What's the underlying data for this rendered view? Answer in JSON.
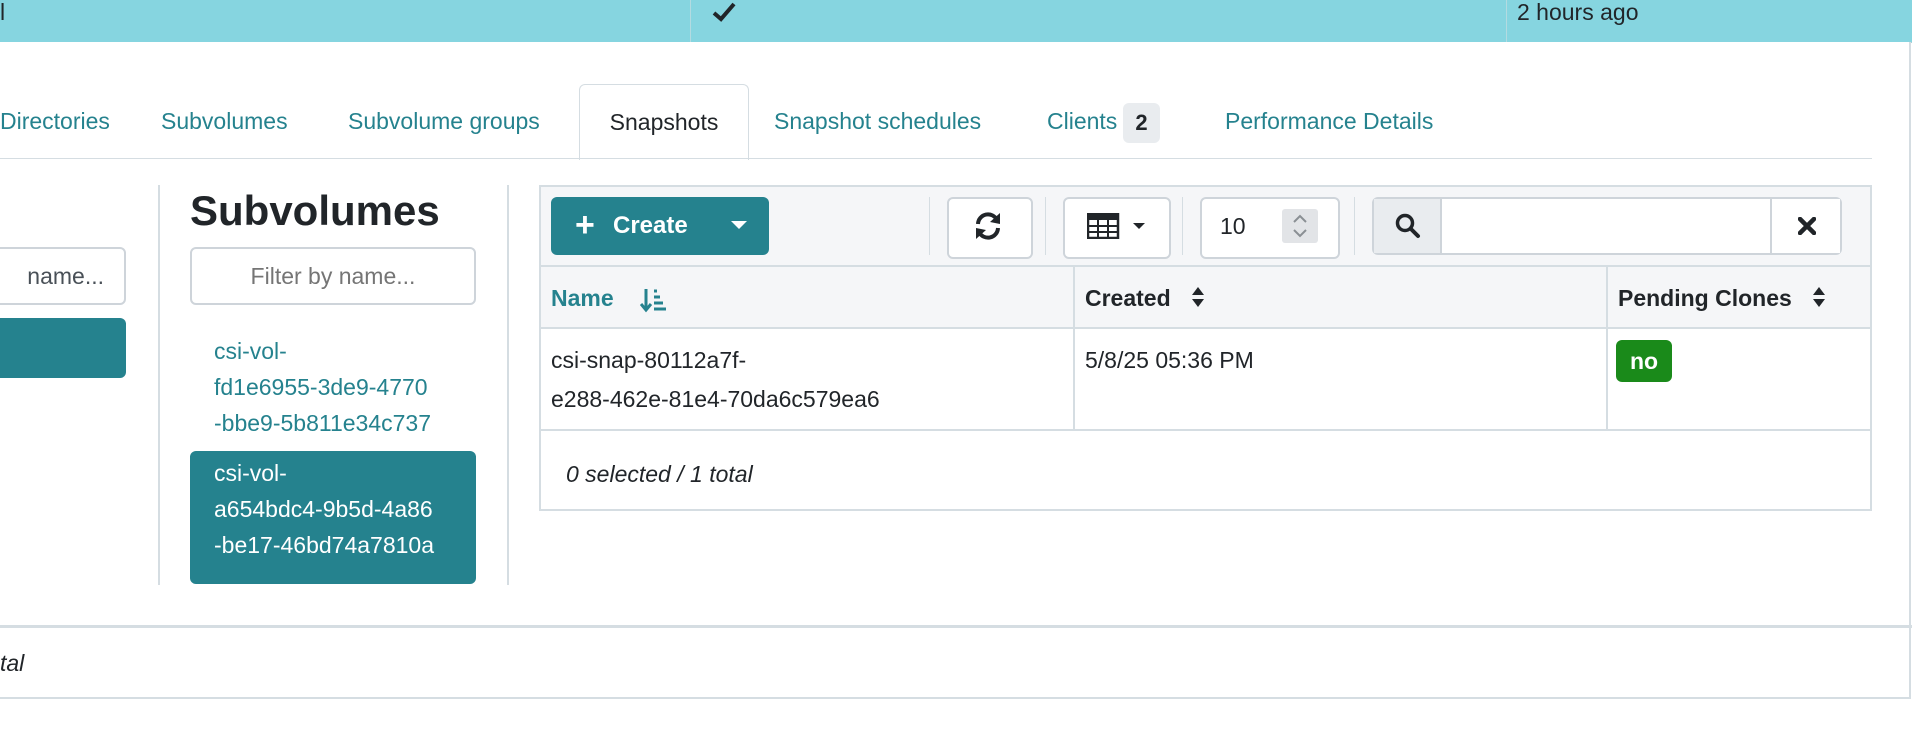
{
  "top_row": {
    "name_fragment": "l",
    "check_icon": "check-icon",
    "last_modified": "2 hours ago"
  },
  "tabs": [
    {
      "label": "Directories"
    },
    {
      "label": "Subvolumes"
    },
    {
      "label": "Subvolume groups"
    },
    {
      "label": "Snapshots",
      "active": true
    },
    {
      "label": "Snapshot schedules"
    },
    {
      "label": "Clients",
      "badge": "2"
    },
    {
      "label": "Performance Details"
    }
  ],
  "left_panel": {
    "filter_fragment": "name..."
  },
  "subvolumes": {
    "heading": "Subvolumes",
    "filter_placeholder": "Filter by name...",
    "items": [
      {
        "line1": "csi-vol-",
        "line2": "fd1e6955-3de9-4770",
        "line3": "-bbe9-5b811e34c737"
      },
      {
        "line1": "csi-vol-",
        "line2": "a654bdc4-9b5d-4a86",
        "line3": "-be17-46bd74a7810a",
        "selected": true
      }
    ]
  },
  "toolbar": {
    "create_label": "Create",
    "page_size": "10",
    "search_value": ""
  },
  "table": {
    "columns": [
      "Name",
      "Created",
      "Pending Clones"
    ],
    "rows": [
      {
        "name_line1": "csi-snap-80112a7f-",
        "name_line2": "e288-462e-81e4-70da6c579ea6",
        "created": "5/8/25 05:36 PM",
        "pending_clones": "no"
      }
    ],
    "footer": "0 selected / 1 total"
  },
  "outer_footer_fragment": "tal",
  "colors": {
    "accent": "#25828e",
    "selected_row": "#86d5e0",
    "success": "#1a8a1a"
  }
}
